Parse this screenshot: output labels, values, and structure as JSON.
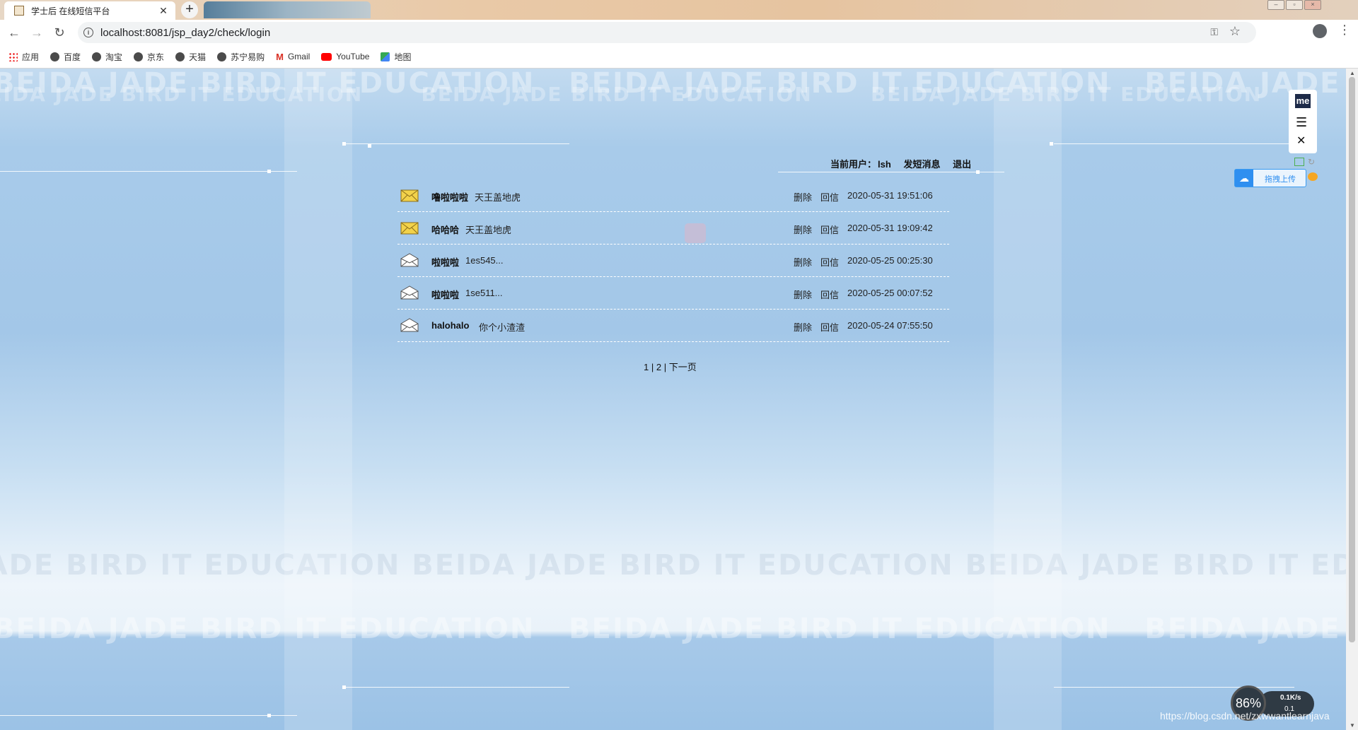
{
  "browser": {
    "tab_title": "学士后 在线短信平台",
    "tab_close": "✕",
    "new_tab": "+",
    "url": "localhost:8081/jsp_day2/check/login",
    "bookmarks": [
      {
        "label": "应用",
        "icon": "apps-grid-icon"
      },
      {
        "label": "百度",
        "icon": "globe-icon"
      },
      {
        "label": "淘宝",
        "icon": "globe-icon"
      },
      {
        "label": "京东",
        "icon": "globe-icon"
      },
      {
        "label": "天猫",
        "icon": "globe-icon"
      },
      {
        "label": "苏宁易购",
        "icon": "globe-icon"
      },
      {
        "label": "Gmail",
        "icon": "gmail-icon"
      },
      {
        "label": "YouTube",
        "icon": "youtube-icon"
      },
      {
        "label": "地图",
        "icon": "maps-icon"
      }
    ]
  },
  "page": {
    "background_text": "BEIDA JADE BIRD IT EDUCATION",
    "userbar": {
      "current_user_label": "当前用户：",
      "username": "lsh",
      "compose": "发短消息",
      "logout": "退出"
    },
    "messages": [
      {
        "sender": "噜啦啦啦",
        "title": "天王盖地虎",
        "delete": "删除",
        "reply": "回信",
        "time": "2020-05-31 19:51:06",
        "status": "unread"
      },
      {
        "sender": "哈哈哈",
        "title": "天王盖地虎",
        "delete": "删除",
        "reply": "回信",
        "time": "2020-05-31 19:09:42",
        "status": "unread"
      },
      {
        "sender": "啦啦啦",
        "title": "1es545...",
        "delete": "删除",
        "reply": "回信",
        "time": "2020-05-25 00:25:30",
        "status": "read"
      },
      {
        "sender": "啦啦啦",
        "title": "1se511...",
        "delete": "删除",
        "reply": "回信",
        "time": "2020-05-25 00:07:52",
        "status": "read"
      },
      {
        "sender": "halohalo",
        "title": "你个小渣渣",
        "delete": "删除",
        "reply": "回信",
        "time": "2020-05-24 07:55:50",
        "status": "read"
      }
    ],
    "pager": {
      "page1": "1",
      "sep1": " | ",
      "page2": "2",
      "sep2": " | ",
      "next": "下一页"
    }
  },
  "widgets": {
    "me_logo": "me",
    "upload_label": "拖拽上传",
    "net_percent": "86%",
    "net_up": "0.1K/s",
    "net_down": "0.1",
    "watermark": "https://blog.csdn.net/zxwwantlearnjava"
  },
  "colors": {
    "accent": "#2f8ff0",
    "unread_icon": "#f2d24a",
    "read_icon": "#ffffff"
  }
}
